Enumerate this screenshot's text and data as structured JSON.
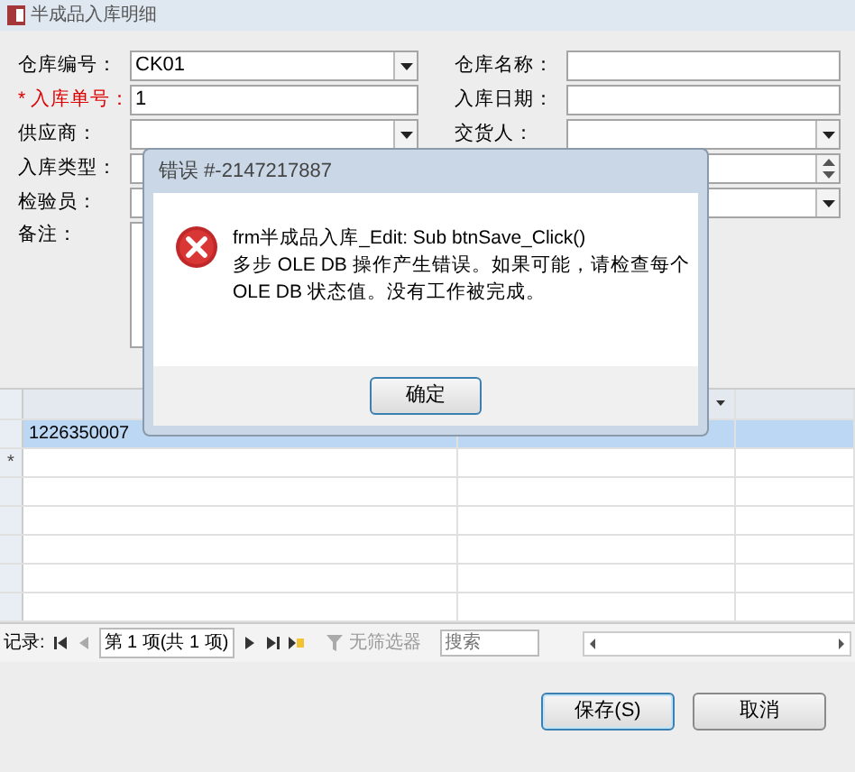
{
  "window": {
    "title": "半成品入库明细"
  },
  "form": {
    "left": [
      {
        "label": "仓库编号：",
        "required": false,
        "kind": "combo",
        "value": "CK01"
      },
      {
        "label": "* 入库单号：",
        "required": true,
        "kind": "text",
        "value": "1"
      },
      {
        "label": "供应商：",
        "required": false,
        "kind": "combo"
      },
      {
        "label": "入库类型：",
        "required": false,
        "kind": "text"
      },
      {
        "label": "检验员：",
        "required": false,
        "kind": "text"
      }
    ],
    "right": [
      {
        "label": "仓库名称：",
        "kind": "text"
      },
      {
        "label": "入库日期：",
        "kind": "text"
      },
      {
        "label": "交货人：",
        "kind": "combo"
      },
      {
        "kind": "spin"
      },
      {
        "kind": "combo"
      }
    ],
    "remarks": {
      "label": "备注："
    }
  },
  "grid": {
    "rows": [
      {
        "kind": "data",
        "cells": [
          "1226350007"
        ],
        "selected": true
      },
      {
        "kind": "new",
        "marker": "*",
        "selected": false
      }
    ]
  },
  "navigator": {
    "label": "记录:",
    "position": "第 1 项(共 1 项)",
    "filter": "无筛选器",
    "search_placeholder": "搜索"
  },
  "buttons": [
    {
      "label": "保存(S)",
      "focused": true
    },
    {
      "label": "取消",
      "focused": false
    }
  ],
  "dialog": {
    "title": "错误 #-2147217887",
    "heading": "frm半成品入库_Edit: Sub btnSave_Click()",
    "message_lines": [
      "多步 OLE DB 操作产生错误。如果可能，请检查每个",
      "OLE DB 状态值。没有工作被完成。"
    ],
    "button": "确定"
  }
}
